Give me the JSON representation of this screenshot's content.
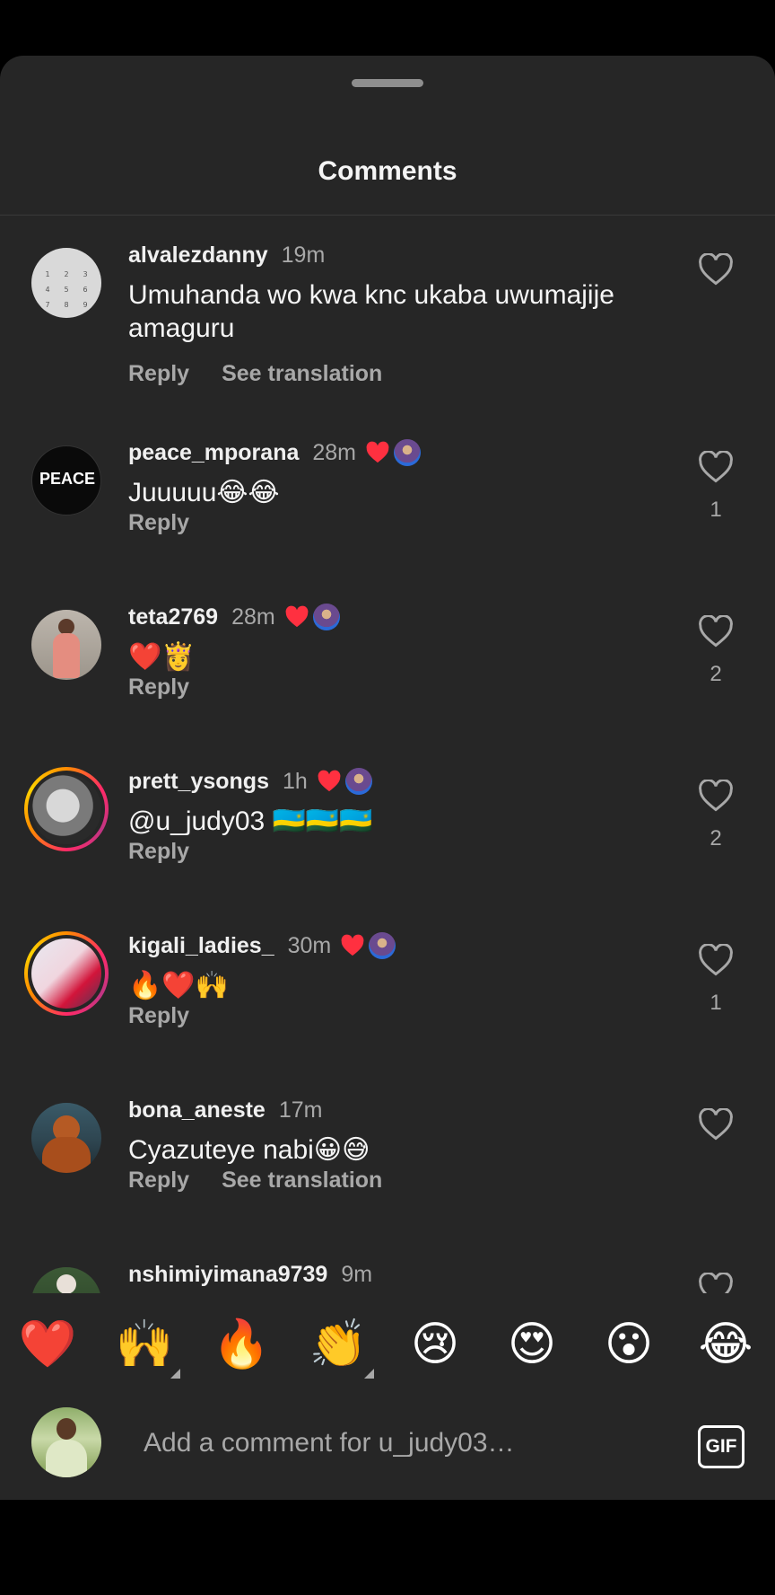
{
  "sheet": {
    "title": "Comments"
  },
  "comments": [
    {
      "username": "alvalezdanny",
      "time": "19m",
      "text": "Umuhanda wo kwa knc ukaba uwumajije amaguru",
      "reply": "Reply",
      "translate": "See translation",
      "likes": "",
      "creator_liked": false
    },
    {
      "username": "peace_mporana",
      "time": "28m",
      "text": "Juuuuu😂😂",
      "reply": "Reply",
      "likes": "1",
      "creator_liked": true,
      "avatar_text": "PEACE"
    },
    {
      "username": "teta2769",
      "time": "28m",
      "text": "❤️👸",
      "reply": "Reply",
      "likes": "2",
      "creator_liked": true
    },
    {
      "username": "prett_ysongs",
      "time": "1h",
      "text": "@u_judy03 🇷🇼🇷🇼🇷🇼",
      "reply": "Reply",
      "likes": "2",
      "creator_liked": true
    },
    {
      "username": "kigali_ladies_",
      "time": "30m",
      "text": "🔥❤️🙌",
      "reply": "Reply",
      "likes": "1",
      "creator_liked": true
    },
    {
      "username": "bona_aneste",
      "time": "17m",
      "text": "Cyazuteye nabi😀😅",
      "reply": "Reply",
      "translate": "See translation",
      "likes": "",
      "creator_liked": false
    },
    {
      "username": "nshimiyimana9739",
      "time": "9m",
      "text": "",
      "reply": "",
      "likes": "",
      "creator_liked": false
    }
  ],
  "reactions": [
    "❤️",
    "🙌",
    "🔥",
    "👏",
    "😢",
    "😍",
    "😮",
    "😂"
  ],
  "composer": {
    "placeholder": "Add a comment for u_judy03…",
    "gif_label": "GIF"
  },
  "colors": {
    "sheet_bg": "#262626",
    "heart_red": "#ff3040",
    "muted": "#a8a8a8"
  }
}
